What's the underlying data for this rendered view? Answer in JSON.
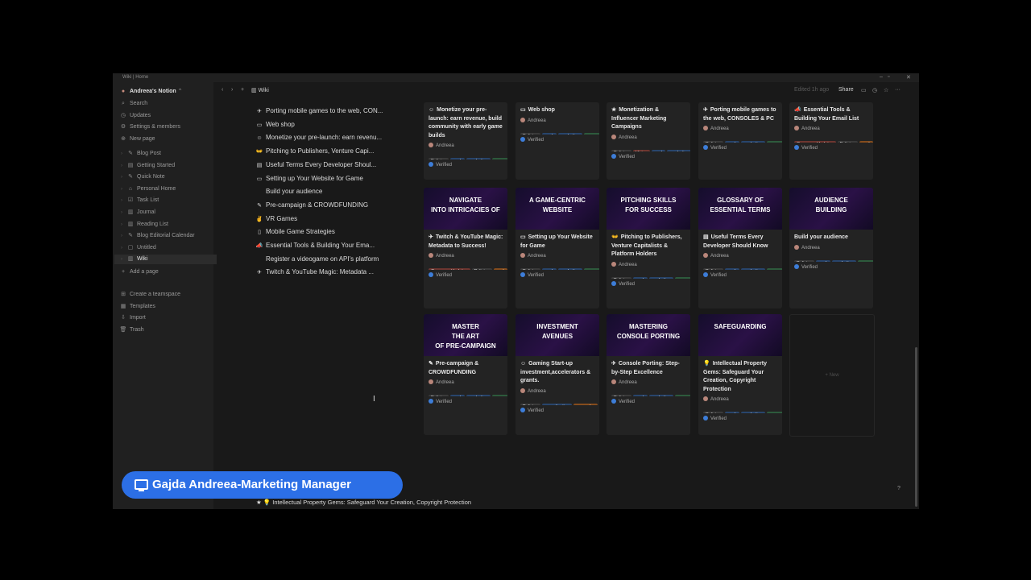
{
  "window": {
    "title": "Wiki | Home"
  },
  "sidebar": {
    "workspace": "Andreea's Notion",
    "top": [
      {
        "label": "Search",
        "icon": "search-icon",
        "glyph": "⌕"
      },
      {
        "label": "Updates",
        "icon": "clock-icon",
        "glyph": "◷"
      },
      {
        "label": "Settings & members",
        "icon": "gear-icon",
        "glyph": "⚙"
      },
      {
        "label": "New page",
        "icon": "plus-circle-icon",
        "glyph": "⊕"
      }
    ],
    "pages": [
      {
        "label": "Blog Post",
        "glyph": "✎"
      },
      {
        "label": "Getting Started",
        "glyph": "▤"
      },
      {
        "label": "Quick Note",
        "glyph": "✎"
      },
      {
        "label": "Personal Home",
        "glyph": "⌂"
      },
      {
        "label": "Task List",
        "glyph": "☑"
      },
      {
        "label": "Journal",
        "glyph": "▥"
      },
      {
        "label": "Reading List",
        "glyph": "▥"
      },
      {
        "label": "Blog Editorial Calendar",
        "glyph": "✎"
      },
      {
        "label": "Untitled",
        "glyph": "▢"
      },
      {
        "label": "Wiki",
        "glyph": "▥"
      }
    ],
    "add_page": "Add a page",
    "bottom": [
      {
        "label": "Create a teamspace",
        "icon": "teamspace-icon",
        "glyph": "⊞"
      },
      {
        "label": "Templates",
        "icon": "templates-icon",
        "glyph": "▦"
      },
      {
        "label": "Import",
        "icon": "import-icon",
        "glyph": "⇩"
      },
      {
        "label": "Trash",
        "icon": "trash-icon",
        "glyph": "🗑"
      }
    ]
  },
  "topbar": {
    "breadcrumb": "Wiki",
    "edited": "Edited 1h ago",
    "share": "Share"
  },
  "list": [
    {
      "glyph": "✈",
      "label": "Porting mobile games to the web, CON..."
    },
    {
      "glyph": "▭",
      "label": "Web shop"
    },
    {
      "glyph": "☺",
      "label": "Monetize your pre-launch: earn revenu..."
    },
    {
      "glyph": "👐",
      "label": "Pitching to Publishers, Venture Capi..."
    },
    {
      "glyph": "▤",
      "label": "Useful Terms Every Developer Shoul..."
    },
    {
      "glyph": "▭",
      "label": "Setting up Your Website for Game"
    },
    {
      "glyph": "",
      "label": "Build your audience"
    },
    {
      "glyph": "✎",
      "label": "Pre-campaign & CROWDFUNDING"
    },
    {
      "glyph": "✌",
      "label": "VR Games"
    },
    {
      "glyph": "▯",
      "label": "Mobile Game Strategies"
    },
    {
      "glyph": "📣",
      "label": "Essential Tools & Building Your Ema..."
    },
    {
      "glyph": "",
      "label": "Register a videogame on API's platform"
    },
    {
      "glyph": "✈",
      "label": "Twitch & YouTube Magic: Metadata ..."
    }
  ],
  "cards": [
    {
      "title": "Monetize your pre-launch: earn revenue, build community with early game builds",
      "glyph": "☺",
      "author": "Andreea",
      "tags": [
        {
          "t": "Policies",
          "c": ""
        },
        {
          "t": "work",
          "c": "blue"
        },
        {
          "t": "marketing",
          "c": "blue"
        },
        {
          "t": "game",
          "c": "green"
        }
      ],
      "verified": "Verified",
      "cover": null
    },
    {
      "title": "Web shop",
      "glyph": "▭",
      "author": "Andreea",
      "tags": [
        {
          "t": "Policies",
          "c": ""
        },
        {
          "t": "work",
          "c": "blue"
        },
        {
          "t": "marketing",
          "c": "blue"
        },
        {
          "t": "game",
          "c": "green"
        }
      ],
      "verified": "Verified",
      "cover": null
    },
    {
      "title": "Monetization & Influencer Marketing Campaigns",
      "glyph": "★",
      "author": "Andreea",
      "tags": [
        {
          "t": "Policies",
          "c": ""
        },
        {
          "t": "Vision",
          "c": "red"
        },
        {
          "t": "work",
          "c": "blue"
        },
        {
          "t": "marketing",
          "c": "blue"
        }
      ],
      "verified": "Verified",
      "cover": null
    },
    {
      "title": "Porting mobile games to the web, CONSOLES & PC",
      "glyph": "✈",
      "author": "Andreea",
      "tags": [
        {
          "t": "Policies",
          "c": ""
        },
        {
          "t": "work",
          "c": "blue"
        },
        {
          "t": "marketing",
          "c": "blue"
        },
        {
          "t": "game",
          "c": "green"
        }
      ],
      "verified": "Verified",
      "cover": null
    },
    {
      "title": "Essential Tools & Building Your Email List",
      "glyph": "📣",
      "author": "Andreea",
      "tags": [
        {
          "t": "Company Updates",
          "c": "red"
        },
        {
          "t": "Policies",
          "c": ""
        },
        {
          "t": "work",
          "c": "orange"
        }
      ],
      "verified": "Verified",
      "cover": null
    },
    {
      "title": "Twitch & YouTube Magic: Metadata to Success!",
      "glyph": "✈",
      "author": "Andreea",
      "tags": [
        {
          "t": "Company Updates",
          "c": "red"
        },
        {
          "t": "Policies",
          "c": ""
        },
        {
          "t": "work",
          "c": "orange"
        }
      ],
      "verified": "Verified",
      "cover": "NAVIGATE\nINTO INTRICACIES OF"
    },
    {
      "title": "Setting up Your Website for Game",
      "glyph": "▭",
      "author": "Andreea",
      "tags": [
        {
          "t": "Policies",
          "c": ""
        },
        {
          "t": "work",
          "c": "blue"
        },
        {
          "t": "marketing",
          "c": "blue"
        },
        {
          "t": "game",
          "c": "green"
        }
      ],
      "verified": "Verified",
      "cover": "A GAME-CENTRIC\nWEBSITE"
    },
    {
      "title": "Pitching to Publishers, Venture Capitalists & Platform Holders",
      "glyph": "👐",
      "author": "Andreea",
      "tags": [
        {
          "t": "Policies",
          "c": ""
        },
        {
          "t": "work",
          "c": "blue"
        },
        {
          "t": "marketing",
          "c": "blue"
        },
        {
          "t": "game",
          "c": "green"
        }
      ],
      "verified": "Verified",
      "cover": "PITCHING SKILLS\nFOR SUCCESS"
    },
    {
      "title": "Useful Terms Every Developer Should Know",
      "glyph": "▤",
      "author": "Andreea",
      "tags": [
        {
          "t": "Policies",
          "c": ""
        },
        {
          "t": "work",
          "c": "blue"
        },
        {
          "t": "marketing",
          "c": "blue"
        },
        {
          "t": "game",
          "c": "green"
        }
      ],
      "verified": "Verified",
      "cover": "GLOSSARY OF\nESSENTIAL TERMS"
    },
    {
      "title": "Build your audience",
      "glyph": "",
      "author": "Andreea",
      "tags": [
        {
          "t": "Policies",
          "c": ""
        },
        {
          "t": "work",
          "c": "blue"
        },
        {
          "t": "marketing",
          "c": "blue"
        },
        {
          "t": "game",
          "c": "green"
        }
      ],
      "verified": "Verified",
      "cover": "AUDIENCE\nBUILDING"
    },
    {
      "title": "Pre-campaign & CROWDFUNDING",
      "glyph": "✎",
      "author": "Andreea",
      "tags": [
        {
          "t": "Policies",
          "c": ""
        },
        {
          "t": "work",
          "c": "blue"
        },
        {
          "t": "marketing",
          "c": "blue"
        },
        {
          "t": "game",
          "c": "green"
        }
      ],
      "verified": "Verified",
      "cover": "MASTER\nTHE ART\nOF PRE-CAMPAIGN"
    },
    {
      "title": "Gaming Start-up investment,accelerators & grants.",
      "glyph": "☺",
      "author": "Andreea",
      "tags": [
        {
          "t": "Policies",
          "c": ""
        },
        {
          "t": "monetization",
          "c": "blue"
        },
        {
          "t": "game dev",
          "c": "orange"
        }
      ],
      "verified": "Verified",
      "cover": "INVESTMENT\nAVENUES"
    },
    {
      "title": "Console Porting: Step-by-Step Excellence",
      "glyph": "✈",
      "author": "Andreea",
      "tags": [
        {
          "t": "Policies",
          "c": ""
        },
        {
          "t": "work",
          "c": "blue"
        },
        {
          "t": "marketing",
          "c": "blue"
        },
        {
          "t": "game",
          "c": "green"
        }
      ],
      "verified": "Verified",
      "cover": "MASTERING\nCONSOLE PORTING"
    },
    {
      "title": "Intellectual Property Gems: Safeguard Your Creation, Copyright Protection",
      "glyph": "💡",
      "author": "Andreea",
      "tags": [
        {
          "t": "Policies",
          "c": ""
        },
        {
          "t": "work",
          "c": "blue"
        },
        {
          "t": "marketing",
          "c": "blue"
        },
        {
          "t": "game",
          "c": "green"
        }
      ],
      "verified": "Verified",
      "cover": "SAFEGUARDING"
    }
  ],
  "new_label": "+ New",
  "help": "?",
  "caption": "Gajda Andreea-Marketing Manager",
  "footer_line": "Intellectual Property Gems: Safeguard Your Creation, Copyright Protection"
}
